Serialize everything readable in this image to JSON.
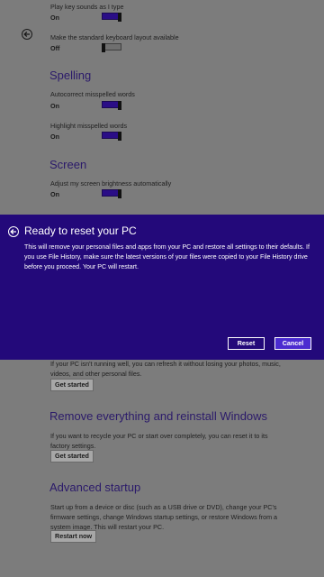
{
  "top": {
    "play_key_sounds": {
      "label": "Play key sounds as I type",
      "state": "On"
    },
    "standard_keyboard": {
      "label": "Make the standard keyboard layout available",
      "state": "Off"
    }
  },
  "spelling": {
    "title": "Spelling",
    "autocorrect": {
      "label": "Autocorrect misspelled words",
      "state": "On"
    },
    "highlight": {
      "label": "Highlight misspelled words",
      "state": "On"
    }
  },
  "screen": {
    "title": "Screen",
    "brightness": {
      "label": "Adjust my screen brightness automatically",
      "state": "On"
    }
  },
  "dialog": {
    "title": "Ready to reset your PC",
    "body": "This will remove your personal files and apps from your PC and restore all settings to their defaults. If you use File History, make sure the latest versions of your files were copied to your File History drive before you proceed. Your PC will restart.",
    "reset_label": "Reset",
    "cancel_label": "Cancel"
  },
  "refresh": {
    "description": "If your PC isn't running well, you can refresh it without losing your photos, music, videos, and other personal files.",
    "button": "Get started"
  },
  "remove": {
    "title": "Remove everything and reinstall Windows",
    "description": "If you want to recycle your PC or start over completely, you can reset it to its factory settings.",
    "button": "Get started"
  },
  "advanced": {
    "title": "Advanced startup",
    "description": "Start up from a device or disc (such as a USB drive or DVD), change your PC's firmware settings, change Windows startup settings, or restore Windows from a system image. This will restart your PC.",
    "button": "Restart now"
  },
  "colors": {
    "accent": "#23097a",
    "background": "#7c7c7c",
    "toggle_on": "#2a0d86"
  }
}
